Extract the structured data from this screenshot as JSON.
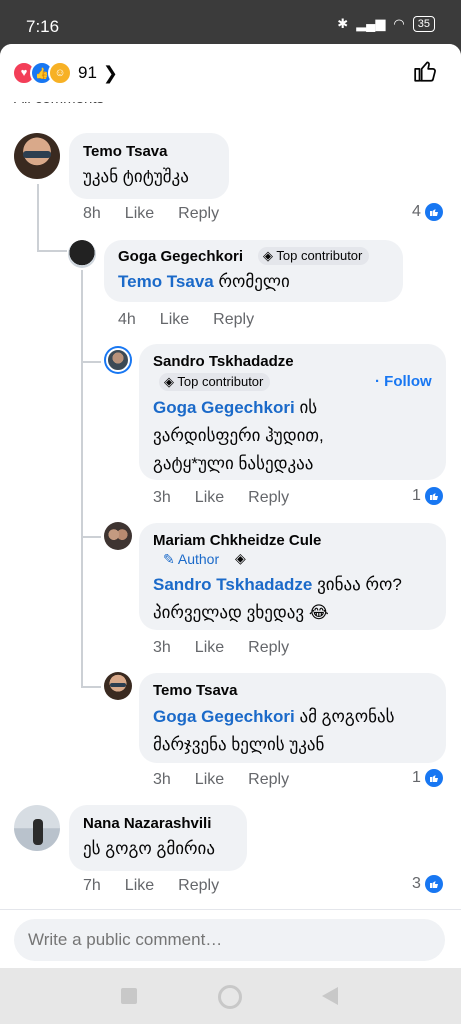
{
  "status_bar": {
    "time": "7:16",
    "battery": "35"
  },
  "header": {
    "reaction_count": "91",
    "partial_label": "All comments"
  },
  "comments": [
    {
      "name": "Temo Tsava",
      "text": "უკან ტიტუშკა",
      "time": "8h",
      "like": "Like",
      "reply": "Reply",
      "reactions": "4"
    },
    {
      "name": "Goga Gegechkori",
      "badge": "Top contributor",
      "mention": "Temo Tsava",
      "text": "რომელი",
      "time": "4h",
      "like": "Like",
      "reply": "Reply"
    },
    {
      "name": "Sandro Tskhadadze",
      "badge": "Top contributor",
      "follow": "· Follow",
      "mention": "Goga Gegechkori",
      "text_line1": "ის",
      "text_line2": "ვარდისფერი ჰუდით,",
      "text_line3": "გატყ*ული ნასედკაა",
      "time": "3h",
      "like": "Like",
      "reply": "Reply",
      "reactions": "1"
    },
    {
      "name": "Mariam Chkheidze Cule",
      "badge": "Author",
      "mention": "Sandro Tskhadadze",
      "text_line1": "ვინაა რო?",
      "text_line2": "პირველად ვხედავ",
      "emoji": "😂",
      "time": "3h",
      "like": "Like",
      "reply": "Reply"
    },
    {
      "name": "Temo Tsava",
      "mention": "Goga Gegechkori",
      "text_line1": "ამ გოგონას",
      "text_line2": "მარჯვენა ხელის უკან",
      "time": "3h",
      "like": "Like",
      "reply": "Reply",
      "reactions": "1"
    },
    {
      "name": "Nana Nazarashvili",
      "text": "ეს გოგო გმირია",
      "time": "7h",
      "like": "Like",
      "reply": "Reply",
      "reactions": "3"
    }
  ],
  "composer": {
    "placeholder": "Write a public comment…"
  },
  "colors": {
    "accent": "#1877f2",
    "mention": "#1b6ac9",
    "bubble": "#f0f2f5"
  }
}
